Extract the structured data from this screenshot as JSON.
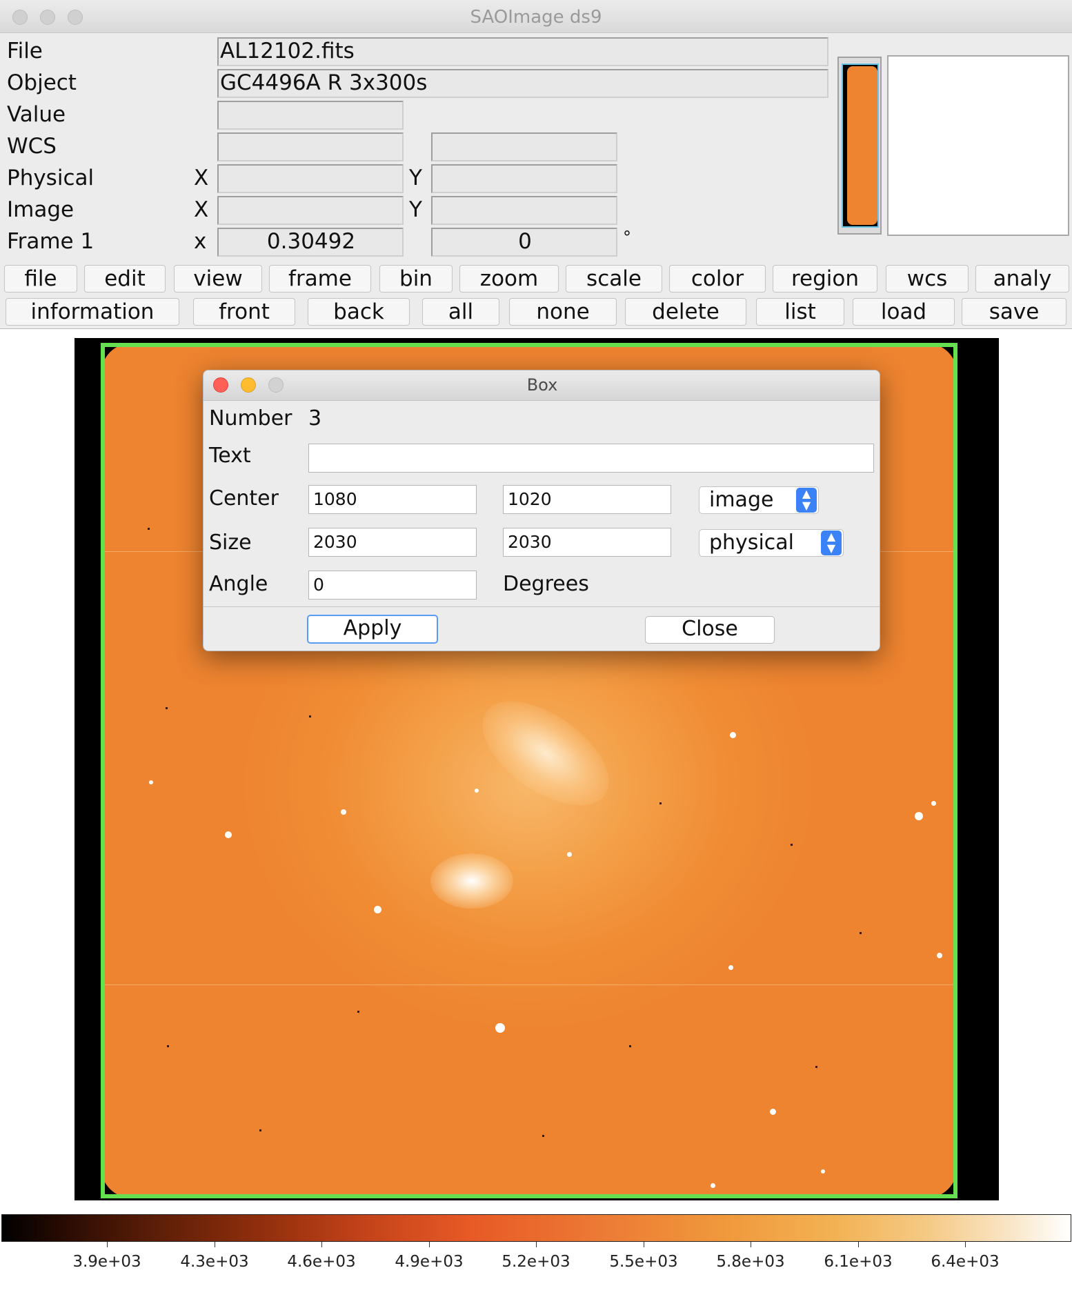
{
  "window": {
    "title": "SAOImage ds9"
  },
  "info": {
    "file_label": "File",
    "file_value": "AL12102.fits",
    "object_label": "Object",
    "object_value": "GC4496A R 3x300s",
    "value_label": "Value",
    "value_value": "",
    "wcs_label": "WCS",
    "wcs_x": "",
    "wcs_y": "",
    "physical_label": "Physical",
    "physical_x_label": "X",
    "physical_y_label": "Y",
    "physical_x": "",
    "physical_y": "",
    "image_label": "Image",
    "image_x_label": "X",
    "image_y_label": "Y",
    "image_x": "",
    "image_y": "",
    "frame_label": "Frame 1",
    "frame_x_label": "x",
    "frame_zoom": "0.30492",
    "frame_angle": "0",
    "degree_symbol": "°"
  },
  "menu_buttons": [
    "file",
    "edit",
    "view",
    "frame",
    "bin",
    "zoom",
    "scale",
    "color",
    "region",
    "wcs",
    "analy"
  ],
  "region_buttons": [
    "information",
    "front",
    "back",
    "all",
    "none",
    "delete",
    "list",
    "load",
    "save"
  ],
  "dialog": {
    "title": "Box",
    "number_label": "Number",
    "number_value": "3",
    "text_label": "Text",
    "text_value": "",
    "center_label": "Center",
    "center_x": "1080",
    "center_y": "1020",
    "center_system": "image",
    "size_label": "Size",
    "size_w": "2030",
    "size_h": "2030",
    "size_system": "physical",
    "angle_label": "Angle",
    "angle_value": "0",
    "angle_unit": "Degrees",
    "apply_label": "Apply",
    "close_label": "Close"
  },
  "colorbar": {
    "ticks": [
      "3.9e+03",
      "4.3e+03",
      "4.6e+03",
      "4.9e+03",
      "5.2e+03",
      "5.5e+03",
      "5.8e+03",
      "6.1e+03",
      "6.4e+03"
    ]
  },
  "colors": {
    "region": "#66e050",
    "image_base": "#ee8430",
    "selector_accent": "#3b82f6"
  }
}
